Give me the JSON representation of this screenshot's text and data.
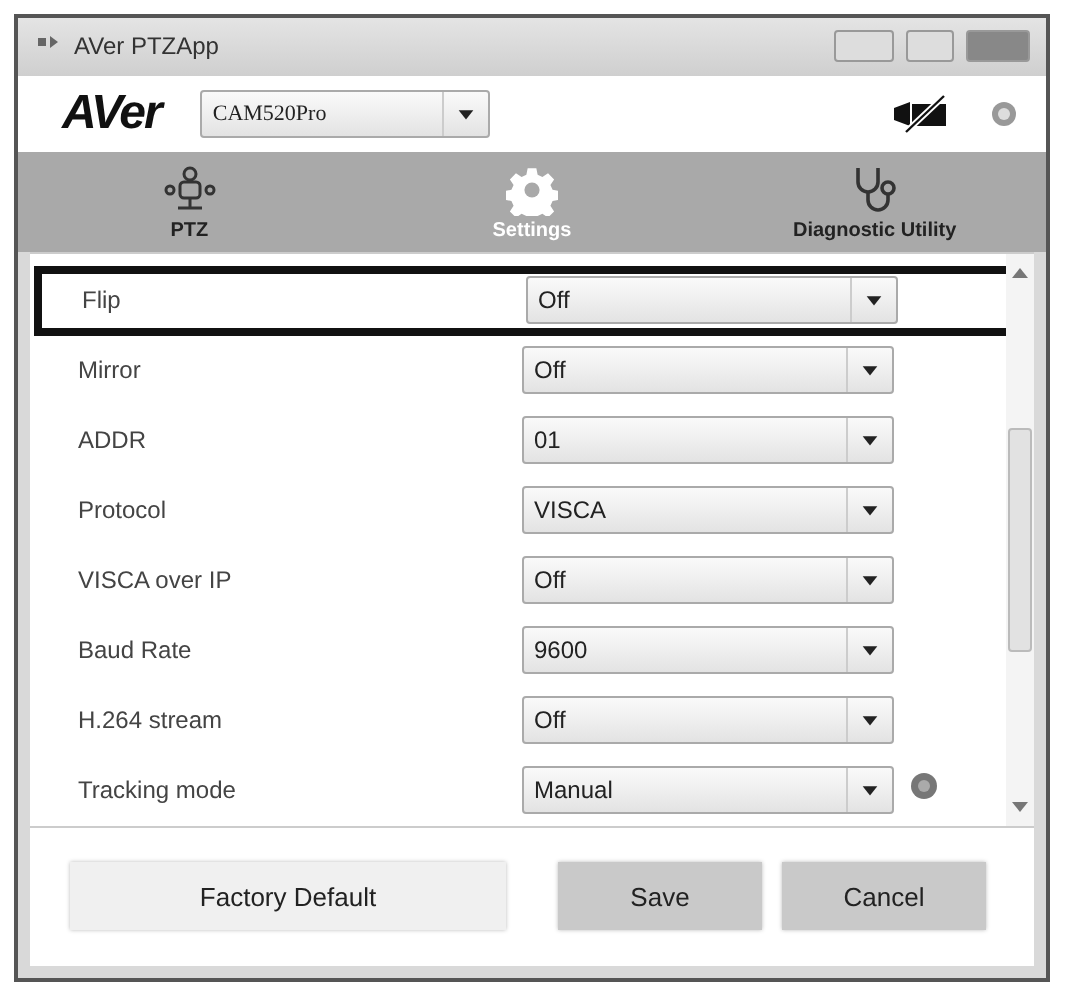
{
  "window": {
    "title": "AVer PTZApp"
  },
  "header": {
    "logo": "AVer",
    "camera": "CAM520Pro"
  },
  "tabs": [
    {
      "label": "PTZ",
      "selected": false
    },
    {
      "label": "Settings",
      "selected": true
    },
    {
      "label": "Diagnostic Utility",
      "selected": false
    }
  ],
  "settings": [
    {
      "label": "Flip",
      "value": "Off",
      "highlighted": true,
      "help": false
    },
    {
      "label": "Mirror",
      "value": "Off",
      "highlighted": false,
      "help": false
    },
    {
      "label": "ADDR",
      "value": "01",
      "highlighted": false,
      "help": false
    },
    {
      "label": "Protocol",
      "value": "VISCA",
      "highlighted": false,
      "help": false
    },
    {
      "label": "VISCA over IP",
      "value": "Off",
      "highlighted": false,
      "help": false
    },
    {
      "label": "Baud Rate",
      "value": "9600",
      "highlighted": false,
      "help": false
    },
    {
      "label": "H.264 stream",
      "value": "Off",
      "highlighted": false,
      "help": false
    },
    {
      "label": "Tracking mode",
      "value": "Manual",
      "highlighted": false,
      "help": true
    }
  ],
  "buttons": [
    {
      "label": "Factory Default",
      "kind": "light"
    },
    {
      "label": "Save",
      "kind": "dark"
    },
    {
      "label": "Cancel",
      "kind": "dark"
    }
  ]
}
